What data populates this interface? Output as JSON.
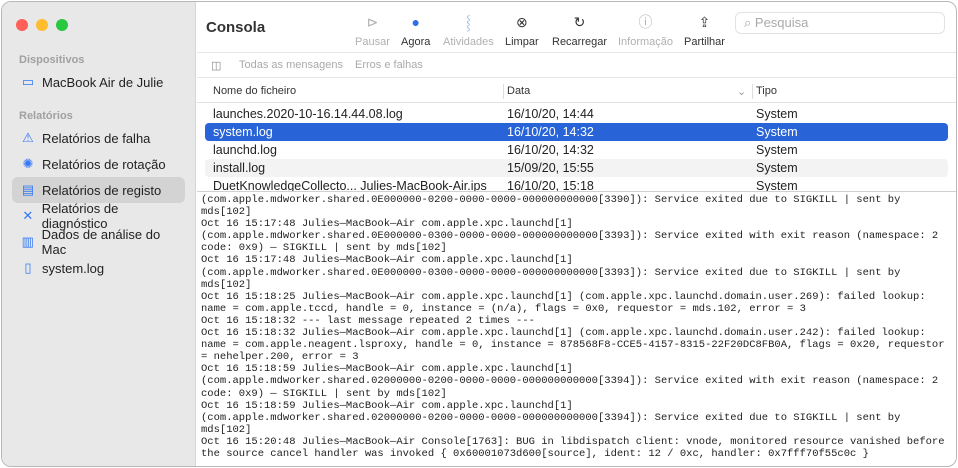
{
  "sidebar": {
    "devices_header": "Dispositivos",
    "device": "MacBook Air de Julie",
    "reports_header": "Relatórios",
    "items": [
      {
        "label": "Relatórios de falha"
      },
      {
        "label": "Relatórios de rotação"
      },
      {
        "label": "Relatórios de registo"
      },
      {
        "label": "Relatórios de diagnóstico"
      },
      {
        "label": "Dados de análise do Mac"
      },
      {
        "label": "system.log"
      }
    ]
  },
  "toolbar": {
    "title": "Consola",
    "pause": "Pausar",
    "now": "Agora",
    "activities": "Atividades",
    "clear": "Limpar",
    "reload": "Recarregar",
    "info": "Informação",
    "share": "Partilhar",
    "search_placeholder": "Pesquisa"
  },
  "filters": {
    "all": "Todas as mensagens",
    "errors": "Erros e falhas"
  },
  "table": {
    "headers": [
      "Nome do ficheiro",
      "Data",
      "Tipo"
    ],
    "rows": [
      [
        "launches.2020-10-16.14.44.08.log",
        "16/10/20, 14:44",
        "System"
      ],
      [
        "system.log",
        "16/10/20, 14:32",
        "System"
      ],
      [
        "launchd.log",
        "16/10/20, 14:32",
        "System"
      ],
      [
        "install.log",
        "15/09/20, 15:55",
        "System"
      ],
      [
        "DuetKnowledgeCollecto... Julies-MacBook-Air.ips",
        "16/10/20, 15:18",
        "System"
      ]
    ]
  },
  "log_lines": [
    "(com.apple.mdworker.shared.0E000000-0200-0000-0000-000000000000[3390]): Service exited due to SIGKILL | sent by",
    "mds[102]",
    "Oct 16 15:17:48 Julies—MacBook—Air com.apple.xpc.launchd[1]",
    "(com.apple.mdworker.shared.0E000000-0300-0000-0000-000000000000[3393]): Service exited with exit reason (namespace: 2",
    "code: 0x9) — SIGKILL | sent by mds[102]",
    "Oct 16 15:17:48 Julies—MacBook—Air com.apple.xpc.launchd[1]",
    "(com.apple.mdworker.shared.0E000000-0300-0000-0000-000000000000[3393]): Service exited due to SIGKILL | sent by",
    "mds[102]",
    "Oct 16 15:18:25 Julies—MacBook—Air com.apple.xpc.launchd[1] (com.apple.xpc.launchd.domain.user.269): failed lookup:",
    "name = com.apple.tccd, handle = 0, instance = (n/a), flags = 0x0, requestor = mds.102, error = 3",
    "Oct 16 15:18:32 --- last message repeated 2 times ---",
    "Oct 16 15:18:32 Julies—MacBook—Air com.apple.xpc.launchd[1] (com.apple.xpc.launchd.domain.user.242): failed lookup:",
    "name = com.apple.neagent.lsproxy, handle = 0, instance = 878568F8-CCE5-4157-8315-22F20DC8FB0A, flags = 0x20, requestor",
    "= nehelper.200, error = 3",
    "Oct 16 15:18:59 Julies—MacBook—Air com.apple.xpc.launchd[1]",
    "(com.apple.mdworker.shared.02000000-0200-0000-0000-000000000000[3394]): Service exited with exit reason (namespace: 2",
    "code: 0x9) — SIGKILL | sent by mds[102]",
    "Oct 16 15:18:59 Julies—MacBook—Air com.apple.xpc.launchd[1]",
    "(com.apple.mdworker.shared.02000000-0200-0000-0000-000000000000[3394]): Service exited due to SIGKILL | sent by",
    "mds[102]",
    "Oct 16 15:20:48 Julies—MacBook—Air Console[1763]: BUG in libdispatch client: vnode, monitored resource vanished before",
    "the source cancel handler was invoked { 0x60001073d600[source], ident: 12 / 0xc, handler: 0x7fff70f55c0c }"
  ]
}
